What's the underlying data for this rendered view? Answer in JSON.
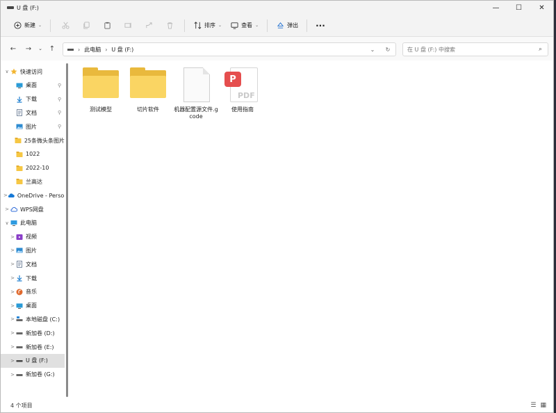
{
  "window": {
    "title": "U 盘 (F:)",
    "controls": {
      "minimize": "—",
      "maximize": "☐",
      "close": "✕"
    }
  },
  "commandbar": {
    "new_label": "新建",
    "sort_label": "排序",
    "view_label": "查看",
    "eject_label": "弹出",
    "more": "···"
  },
  "address": {
    "crumbs": [
      "此电脑",
      "U 盘 (F:)"
    ],
    "search_placeholder": "在 U 盘 (F:) 中搜索"
  },
  "sidebar": {
    "items": [
      {
        "label": "快速访问",
        "expander": "∨",
        "icon": "star-icon",
        "indent": 0,
        "pinned": false
      },
      {
        "label": "桌面",
        "expander": "",
        "icon": "desktop-icon",
        "indent": 1,
        "pinned": true
      },
      {
        "label": "下载",
        "expander": "",
        "icon": "download-icon",
        "indent": 1,
        "pinned": true
      },
      {
        "label": "文档",
        "expander": "",
        "icon": "document-icon",
        "indent": 1,
        "pinned": true
      },
      {
        "label": "图片",
        "expander": "",
        "icon": "picture-icon",
        "indent": 1,
        "pinned": true
      },
      {
        "label": "25条微头条图片",
        "expander": "",
        "icon": "folder-icon",
        "indent": 1,
        "pinned": false
      },
      {
        "label": "1022",
        "expander": "",
        "icon": "folder-icon",
        "indent": 1,
        "pinned": false
      },
      {
        "label": "2022-10",
        "expander": "",
        "icon": "folder-icon",
        "indent": 1,
        "pinned": false
      },
      {
        "label": "兰高达",
        "expander": "",
        "icon": "folder-icon",
        "indent": 1,
        "pinned": false
      },
      {
        "label": "OneDrive - Personal",
        "expander": ">",
        "icon": "cloud-icon",
        "indent": 0,
        "pinned": false
      },
      {
        "label": "WPS网盘",
        "expander": ">",
        "icon": "cloud-drive-icon",
        "indent": 0,
        "pinned": false
      },
      {
        "label": "此电脑",
        "expander": "∨",
        "icon": "computer-icon",
        "indent": 0,
        "pinned": false
      },
      {
        "label": "视频",
        "expander": ">",
        "icon": "video-icon",
        "indent": 1,
        "pinned": false
      },
      {
        "label": "图片",
        "expander": ">",
        "icon": "picture-icon",
        "indent": 1,
        "pinned": false
      },
      {
        "label": "文档",
        "expander": ">",
        "icon": "document-icon",
        "indent": 1,
        "pinned": false
      },
      {
        "label": "下载",
        "expander": ">",
        "icon": "download-icon",
        "indent": 1,
        "pinned": false
      },
      {
        "label": "音乐",
        "expander": ">",
        "icon": "music-icon",
        "indent": 1,
        "pinned": false
      },
      {
        "label": "桌面",
        "expander": ">",
        "icon": "desktop-icon",
        "indent": 1,
        "pinned": false
      },
      {
        "label": "本地磁盘 (C:)",
        "expander": ">",
        "icon": "system-drive-icon",
        "indent": 1,
        "pinned": false
      },
      {
        "label": "新加卷 (D:)",
        "expander": ">",
        "icon": "drive-icon",
        "indent": 1,
        "pinned": false
      },
      {
        "label": "新加卷 (E:)",
        "expander": ">",
        "icon": "drive-icon",
        "indent": 1,
        "pinned": false
      },
      {
        "label": "U 盘 (F:)",
        "expander": ">",
        "icon": "usb-drive-icon",
        "indent": 1,
        "pinned": false,
        "selected": true
      },
      {
        "label": "新加卷 (G:)",
        "expander": ">",
        "icon": "drive-icon",
        "indent": 1,
        "pinned": false
      }
    ]
  },
  "files": [
    {
      "name": "测试模型",
      "type": "folder"
    },
    {
      "name": "切片软件",
      "type": "folder"
    },
    {
      "name": "机器配置源文件.gcode",
      "type": "document"
    },
    {
      "name": "使用指南",
      "type": "pdf"
    }
  ],
  "status": {
    "item_count": "4 个项目"
  },
  "colors": {
    "folder_front": "#fad563",
    "folder_back": "#e9b93d",
    "pdf_red": "#e54e4e",
    "selection": "#e0e0e0"
  }
}
